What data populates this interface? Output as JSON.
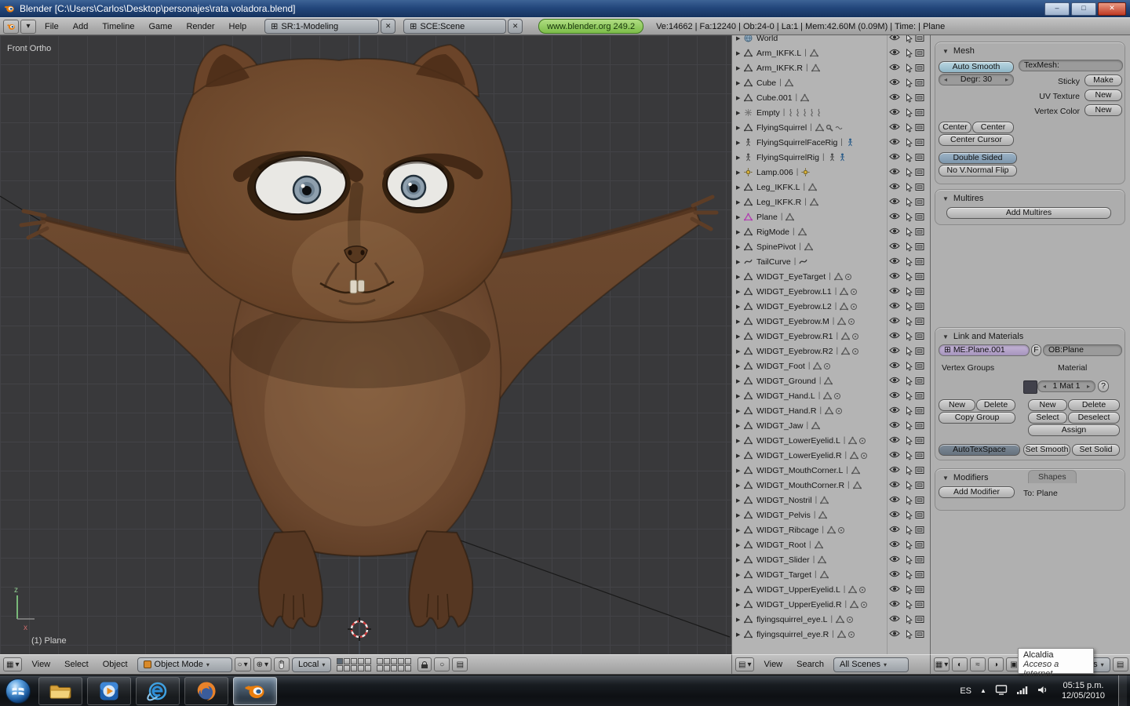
{
  "window": {
    "title": "Blender [C:\\Users\\Carlos\\Desktop\\personajes\\rata voladora.blend]",
    "minimize": "–",
    "maximize": "□",
    "close": "✕"
  },
  "glyphs": {
    "dropdown": "▾",
    "collapse": "▼",
    "expand": "▶",
    "left": "◂",
    "right": "▸",
    "x": "✕",
    "datablock": "⊞",
    "tray_up": "▲",
    "grid": "▦",
    "circle": "○",
    "pivot": "⊕",
    "list": "▤",
    "sep": "|"
  },
  "topbar": {
    "menus": [
      "File",
      "Add",
      "Timeline",
      "Game",
      "Render",
      "Help"
    ],
    "screen": "SR:1-Modeling",
    "scene": "SCE:Scene",
    "web": "www.blender.org 249.2",
    "stats": "Ve:14662 | Fa:12240 | Ob:24-0 | La:1 | Mem:42.60M (0.09M) | Time: | Plane"
  },
  "viewport": {
    "view_label": "Front Ortho",
    "object_label": "(1) Plane",
    "axis_z": "z",
    "axis_x": "x"
  },
  "view3d_header": {
    "menus": [
      "View",
      "Select",
      "Object"
    ],
    "mode": "Object Mode",
    "orientation": "Local"
  },
  "outliner": {
    "header": {
      "menus": [
        "View",
        "Search"
      ],
      "scenes": "All Scenes"
    },
    "items": [
      {
        "name": "World",
        "type": "world",
        "aux": []
      },
      {
        "name": "Arm_IKFK.L",
        "type": "mesh",
        "aux": [
          "mesh-data"
        ]
      },
      {
        "name": "Arm_IKFK.R",
        "type": "mesh",
        "aux": [
          "mesh-data"
        ]
      },
      {
        "name": "Cube",
        "type": "mesh",
        "aux": [
          "mesh-data"
        ]
      },
      {
        "name": "Cube.001",
        "type": "mesh",
        "aux": [
          "mesh-data"
        ]
      },
      {
        "name": "Empty",
        "type": "empty",
        "aux": [
          "constraint",
          "constraint",
          "constraint",
          "constraint",
          "constraint"
        ]
      },
      {
        "name": "FlyingSquirrel",
        "type": "mesh",
        "aux": [
          "mesh-data",
          "modifier",
          "physics"
        ]
      },
      {
        "name": "FlyingSquirrelFaceRig",
        "type": "armature",
        "aux": [
          "pose"
        ]
      },
      {
        "name": "FlyingSquirrelRig",
        "type": "armature",
        "aux": [
          "armature-data",
          "pose"
        ]
      },
      {
        "name": "Lamp.006",
        "type": "lamp",
        "aux": [
          "lamp-data"
        ]
      },
      {
        "name": "Leg_IKFK.L",
        "type": "mesh",
        "aux": [
          "mesh-data"
        ]
      },
      {
        "name": "Leg_IKFK.R",
        "type": "mesh",
        "aux": [
          "mesh-data"
        ]
      },
      {
        "name": "Plane",
        "type": "mesh",
        "aux": [
          "mesh-data"
        ],
        "active": true
      },
      {
        "name": "RigMode",
        "type": "mesh",
        "aux": [
          "mesh-data"
        ]
      },
      {
        "name": "SpinePivot",
        "type": "mesh",
        "aux": [
          "mesh-data"
        ]
      },
      {
        "name": "TailCurve",
        "type": "curve",
        "aux": [
          "curve-data"
        ]
      },
      {
        "name": "WIDGT_EyeTarget",
        "type": "mesh",
        "aux": [
          "mesh-data",
          "anim"
        ]
      },
      {
        "name": "WIDGT_Eyebrow.L1",
        "type": "mesh",
        "aux": [
          "mesh-data",
          "anim"
        ]
      },
      {
        "name": "WIDGT_Eyebrow.L2",
        "type": "mesh",
        "aux": [
          "mesh-data",
          "anim"
        ]
      },
      {
        "name": "WIDGT_Eyebrow.M",
        "type": "mesh",
        "aux": [
          "mesh-data",
          "anim"
        ]
      },
      {
        "name": "WIDGT_Eyebrow.R1",
        "type": "mesh",
        "aux": [
          "mesh-data",
          "anim"
        ]
      },
      {
        "name": "WIDGT_Eyebrow.R2",
        "type": "mesh",
        "aux": [
          "mesh-data",
          "anim"
        ]
      },
      {
        "name": "WIDGT_Foot",
        "type": "mesh",
        "aux": [
          "mesh-data",
          "anim"
        ]
      },
      {
        "name": "WIDGT_Ground",
        "type": "mesh",
        "aux": [
          "mesh-data"
        ]
      },
      {
        "name": "WIDGT_Hand.L",
        "type": "mesh",
        "aux": [
          "mesh-data",
          "anim"
        ]
      },
      {
        "name": "WIDGT_Hand.R",
        "type": "mesh",
        "aux": [
          "mesh-data",
          "anim"
        ]
      },
      {
        "name": "WIDGT_Jaw",
        "type": "mesh",
        "aux": [
          "mesh-data"
        ]
      },
      {
        "name": "WIDGT_LowerEyelid.L",
        "type": "mesh",
        "aux": [
          "mesh-data",
          "anim"
        ]
      },
      {
        "name": "WIDGT_LowerEyelid.R",
        "type": "mesh",
        "aux": [
          "mesh-data",
          "anim"
        ]
      },
      {
        "name": "WIDGT_MouthCorner.L",
        "type": "mesh",
        "aux": [
          "mesh-data"
        ]
      },
      {
        "name": "WIDGT_MouthCorner.R",
        "type": "mesh",
        "aux": [
          "mesh-data"
        ]
      },
      {
        "name": "WIDGT_Nostril",
        "type": "mesh",
        "aux": [
          "mesh-data"
        ]
      },
      {
        "name": "WIDGT_Pelvis",
        "type": "mesh",
        "aux": [
          "mesh-data"
        ]
      },
      {
        "name": "WIDGT_Ribcage",
        "type": "mesh",
        "aux": [
          "mesh-data",
          "anim"
        ]
      },
      {
        "name": "WIDGT_Root",
        "type": "mesh",
        "aux": [
          "mesh-data"
        ]
      },
      {
        "name": "WIDGT_Slider",
        "type": "mesh",
        "aux": [
          "mesh-data"
        ]
      },
      {
        "name": "WIDGT_Target",
        "type": "mesh",
        "aux": [
          "mesh-data"
        ]
      },
      {
        "name": "WIDGT_UpperEyelid.L",
        "type": "mesh",
        "aux": [
          "mesh-data",
          "anim"
        ]
      },
      {
        "name": "WIDGT_UpperEyelid.R",
        "type": "mesh",
        "aux": [
          "mesh-data",
          "anim"
        ]
      },
      {
        "name": "flyingsquirrel_eye.L",
        "type": "mesh",
        "aux": [
          "mesh-data",
          "anim"
        ]
      },
      {
        "name": "flyingsquirrel_eye.R",
        "type": "mesh",
        "aux": [
          "mesh-data",
          "anim"
        ]
      }
    ]
  },
  "panels": {
    "mesh": {
      "title": "Mesh",
      "auto_smooth": "Auto Smooth",
      "degr": "Degr: 30",
      "texmesh": "TexMesh:",
      "sticky": "Sticky",
      "make": "Make",
      "uv_texture": "UV Texture",
      "new_uv": "New",
      "vertex_color": "Vertex Color",
      "new_vcol": "New",
      "center": "Center",
      "center_new": "Center New",
      "center_cursor": "Center Cursor",
      "double_sided": "Double Sided",
      "no_vnormal_flip": "No V.Normal Flip"
    },
    "multires": {
      "title": "Multires",
      "add_multires": "Add Multires"
    },
    "link": {
      "title": "Link and Materials",
      "me": "ME:Plane.001",
      "f": "F",
      "ob": "OB:Plane",
      "vertex_groups": "Vertex Groups",
      "material": "Material",
      "mat_index": "1 Mat 1",
      "help": "?",
      "new_group": "New",
      "delete_group": "Delete",
      "copy_group": "Copy Group",
      "new_mat": "New",
      "delete_mat": "Delete",
      "select": "Select",
      "deselect": "Deselect",
      "assign": "Assign",
      "autotexspace": "AutoTexSpace",
      "set_smooth": "Set Smooth",
      "set_solid": "Set Solid"
    },
    "modifiers": {
      "title": "Modifiers",
      "shapes": "Shapes",
      "add_modifier": "Add Modifier",
      "to": "To: Plane"
    }
  },
  "buttons_header": {
    "panels_label": "Panels",
    "icons": [
      "◐",
      "≈",
      "◑",
      "▣",
      "◎",
      "⊞"
    ]
  },
  "tooltip": {
    "title": "Alcaldia",
    "subtitle": "Acceso a Internet"
  },
  "taskbar": {
    "language": "ES",
    "time": "05:15 p.m.",
    "date": "12/05/2010",
    "apps": [
      {
        "name": "windows-explorer",
        "active": false
      },
      {
        "name": "media-player",
        "active": false
      },
      {
        "name": "internet-explorer",
        "active": false
      },
      {
        "name": "firefox",
        "active": false
      },
      {
        "name": "blender",
        "active": true
      }
    ]
  },
  "colors": {
    "viewport_bg": "#39393b",
    "panel_bg": "#adadad",
    "toggle_on_blue": "#7d96ac",
    "web_button_green": "#7cbd49",
    "character_brown": "#6b472e"
  }
}
